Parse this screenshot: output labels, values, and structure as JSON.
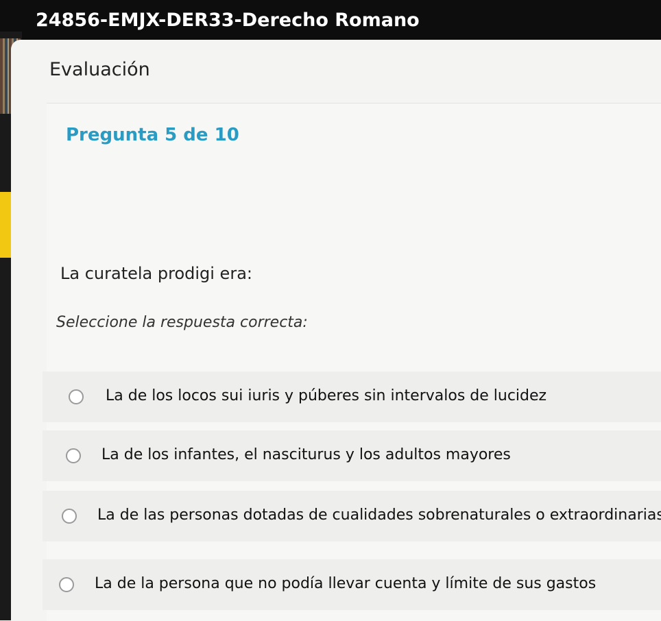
{
  "header": {
    "course_title": "24856-EMJX-DER33-Derecho Romano"
  },
  "page": {
    "section_title": "Evaluación"
  },
  "question": {
    "counter": "Pregunta 5 de 10",
    "text": "La curatela prodigi era:",
    "instruction": "Seleccione la respuesta correcta:",
    "options": [
      {
        "label": "La de los locos sui iuris y púberes sin intervalos de lucidez",
        "selected": false
      },
      {
        "label": "La de los infantes, el nasciturus y los adultos mayores",
        "selected": false
      },
      {
        "label": "La de las personas dotadas de cualidades sobrenaturales o extraordinarias",
        "selected": false
      },
      {
        "label": "La de la persona que no podía llevar cuenta y límite de sus gastos",
        "selected": false
      }
    ]
  },
  "colors": {
    "header_bg": "#0d0d0d",
    "accent_blue": "#2a9bc2",
    "accent_yellow": "#f2c813"
  }
}
